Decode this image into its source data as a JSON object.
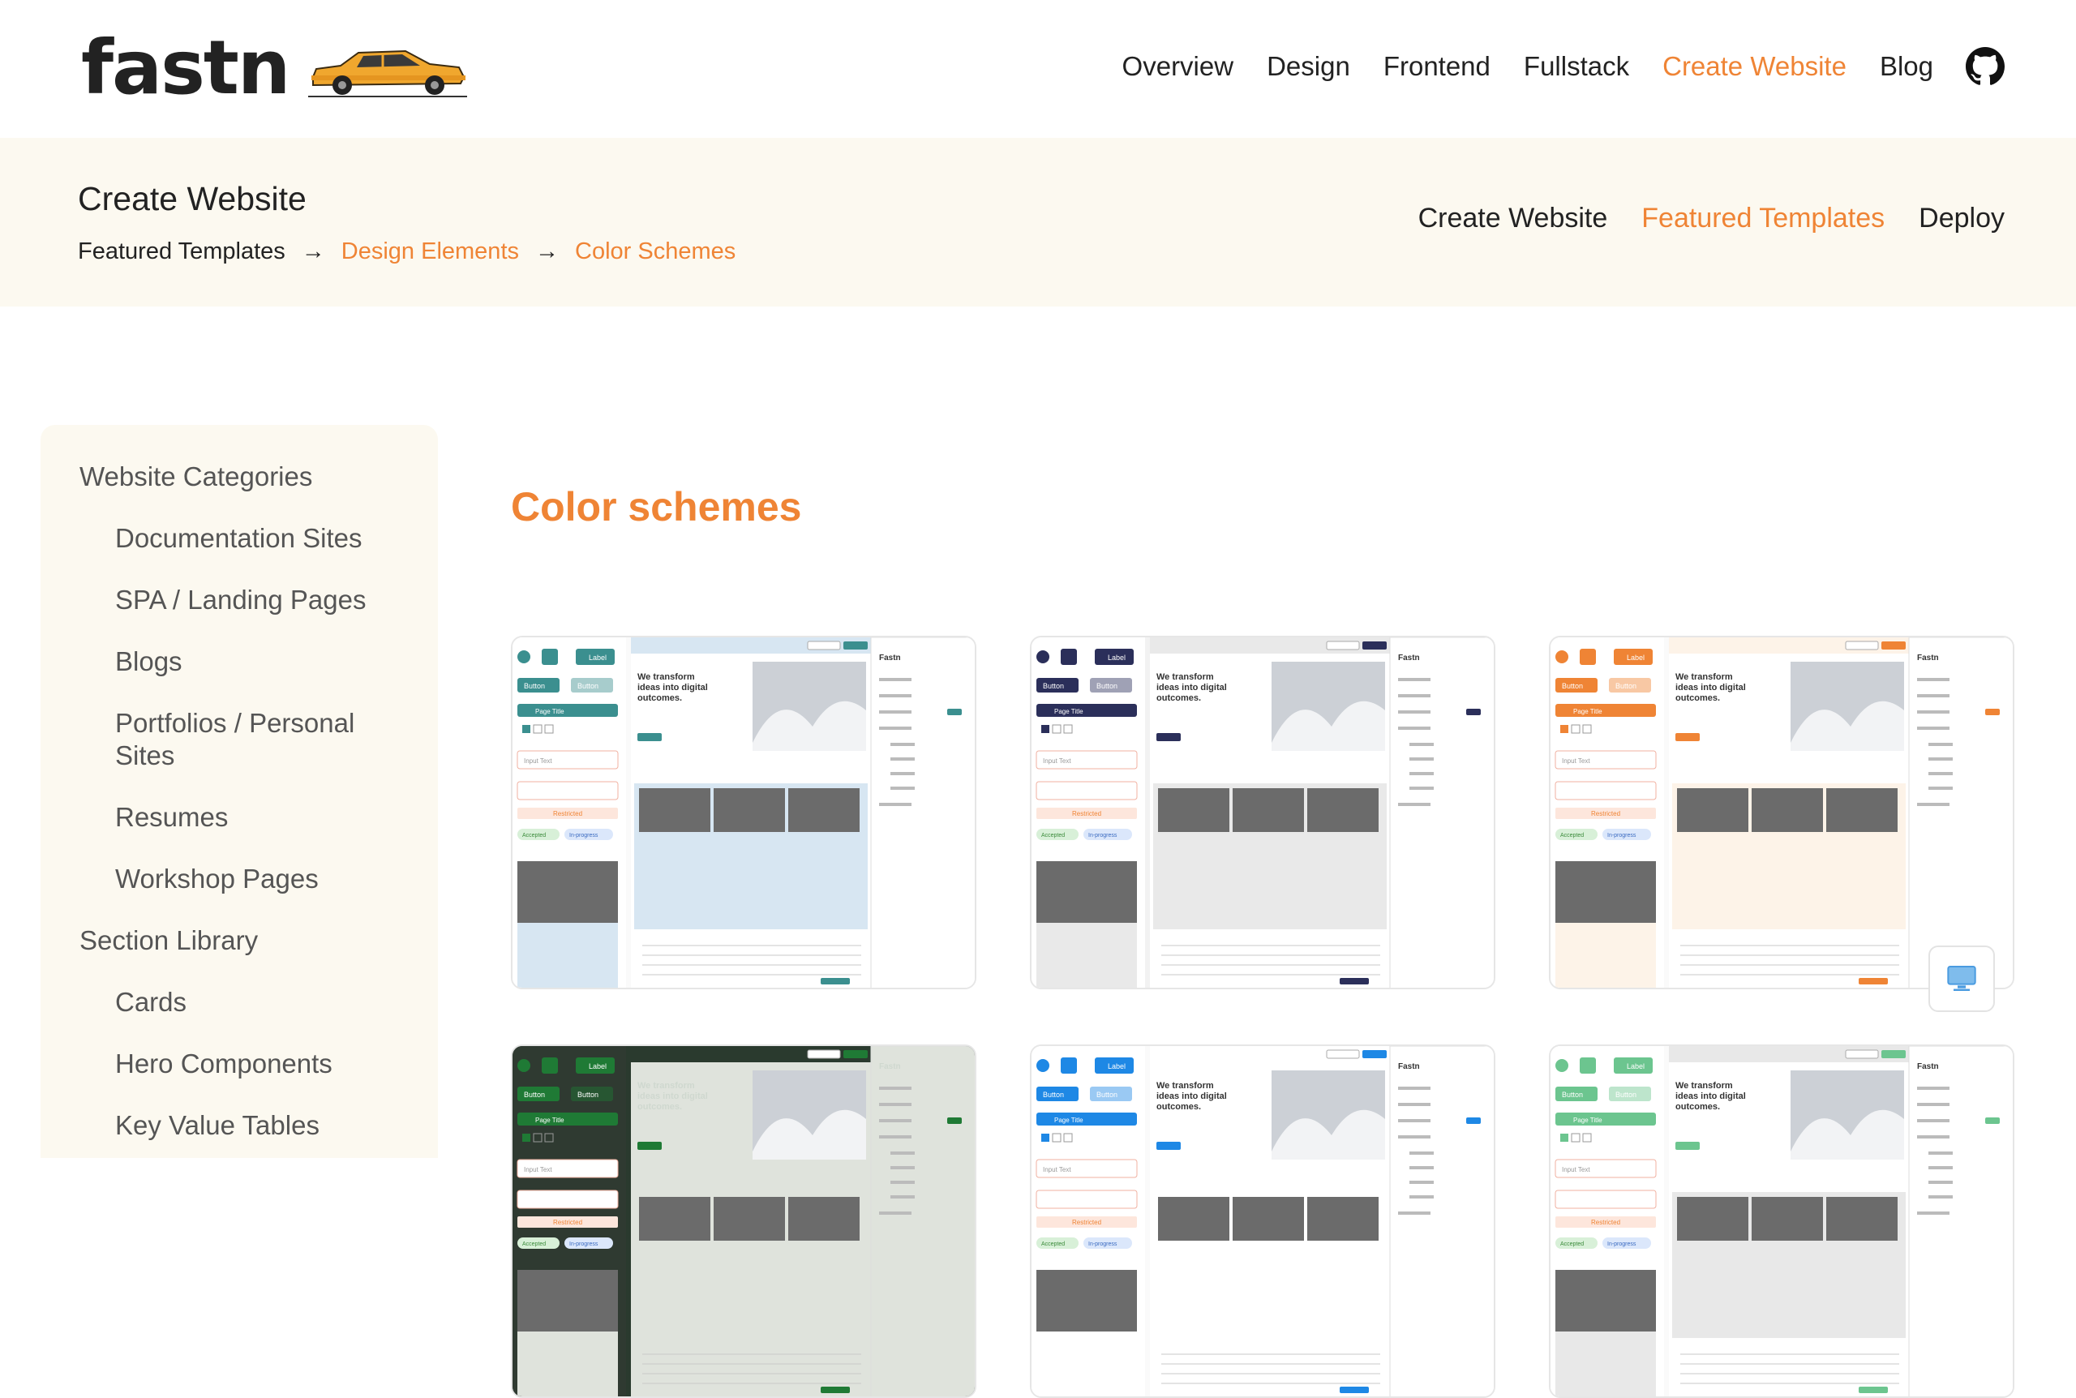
{
  "logo": {
    "text": "fastn",
    "icon": "car-icon"
  },
  "nav": {
    "items": [
      {
        "label": "Overview"
      },
      {
        "label": "Design"
      },
      {
        "label": "Frontend"
      },
      {
        "label": "Fullstack"
      },
      {
        "label": "Create Website",
        "active": true
      },
      {
        "label": "Blog"
      }
    ],
    "github_icon": "github-icon"
  },
  "subheader": {
    "title": "Create Website",
    "breadcrumb": [
      "Featured Templates",
      "Design Elements",
      "Color Schemes"
    ],
    "tabs": [
      {
        "label": "Create Website"
      },
      {
        "label": "Featured Templates",
        "active": true
      },
      {
        "label": "Deploy"
      }
    ]
  },
  "sidebar": {
    "items": [
      {
        "label": "Website Categories",
        "level": 0
      },
      {
        "label": "Documentation Sites",
        "level": 1
      },
      {
        "label": "SPA / Landing Pages",
        "level": 1
      },
      {
        "label": "Blogs",
        "level": 1
      },
      {
        "label": "Portfolios / Personal",
        "level": 1
      },
      {
        "label": "Sites",
        "level": 1
      },
      {
        "label": "Resumes",
        "level": 1
      },
      {
        "label": "Workshop Pages",
        "level": 1
      },
      {
        "label": "Section Library",
        "level": 0
      },
      {
        "label": "Cards",
        "level": 1
      },
      {
        "label": "Hero Components",
        "level": 1
      },
      {
        "label": "Key Value Tables",
        "level": 1
      }
    ]
  },
  "main": {
    "title": "Color schemes",
    "cards": [
      {
        "scheme": "teal",
        "accent": "#3b8f8f",
        "bg": "#ffffff",
        "panel": "#d7e6f2"
      },
      {
        "scheme": "navy",
        "accent": "#2b2f5a",
        "bg": "#f2f2f2",
        "panel": "#e9e9e9"
      },
      {
        "scheme": "orange",
        "accent": "#ef8435",
        "bg": "#ffffff",
        "panel": "#fdf3e8"
      },
      {
        "scheme": "green",
        "accent": "#1f7a35",
        "bg": "#2a3a2e",
        "panel": "#dfe3dc"
      },
      {
        "scheme": "blue",
        "accent": "#1e88e5",
        "bg": "#ffffff",
        "panel": "#ffffff"
      },
      {
        "scheme": "mint",
        "accent": "#6cc58f",
        "bg": "#ffffff",
        "panel": "#e8e8e8"
      }
    ],
    "preview_texts": {
      "hero": "We transform ideas into digital outcomes.",
      "button": "Button",
      "label": "Label",
      "page_title": "Page Title",
      "input": "Input Text",
      "restricted": "Restricted",
      "accepted": "Accepted",
      "in_progress": "In-progress",
      "brand": "Fastn"
    },
    "device_icon": "desktop-icon"
  },
  "colors": {
    "accent": "#ef8435",
    "subheader_bg": "#fcf9f0",
    "text": "#222222"
  }
}
